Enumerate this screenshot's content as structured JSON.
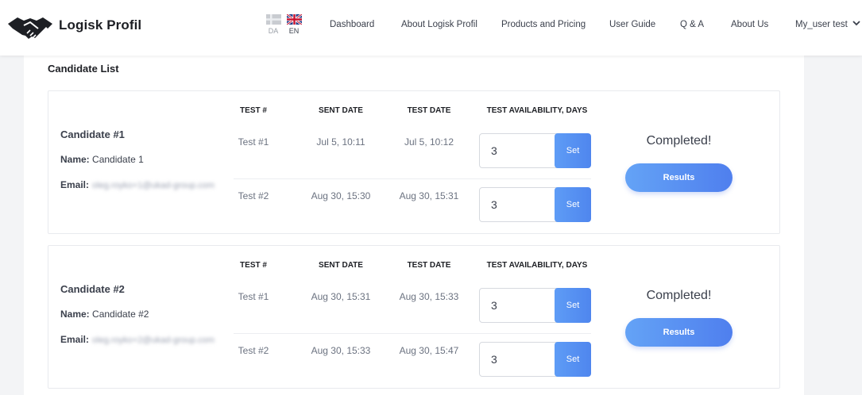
{
  "header": {
    "brand": "Logisk Profil",
    "languages": [
      {
        "code": "DA",
        "active": false
      },
      {
        "code": "EN",
        "active": true
      }
    ],
    "nav": [
      "Dashboard",
      "About Logisk Profil",
      "Products and Pricing",
      "User Guide",
      "Q & A",
      "About Us"
    ],
    "user_menu": "My_user test"
  },
  "page": {
    "title": "Candidate List"
  },
  "table_headers": {
    "test": "TEST #",
    "sent_date": "SENT DATE",
    "test_date": "TEST DATE",
    "availability": "TEST AVAILABILITY, DAYS"
  },
  "labels": {
    "name": "Name:",
    "email": "Email:",
    "set": "Set",
    "results": "Results"
  },
  "candidates": [
    {
      "title": "Candidate #1",
      "name": "Candidate 1",
      "email": "oleg.royko+1@ukad-group.com",
      "status": "Completed!",
      "tests": [
        {
          "test": "Test #1",
          "sent": "Jul 5, 10:11",
          "taken": "Jul 5, 10:12",
          "availability": "3"
        },
        {
          "test": "Test #2",
          "sent": "Aug 30, 15:30",
          "taken": "Aug 30, 15:31",
          "availability": "3"
        }
      ]
    },
    {
      "title": "Candidate #2",
      "name": "Candidate #2",
      "email": "oleg.royko+2@ukad-group.com",
      "status": "Completed!",
      "tests": [
        {
          "test": "Test #1",
          "sent": "Aug 30, 15:31",
          "taken": "Aug 30, 15:33",
          "availability": "3"
        },
        {
          "test": "Test #2",
          "sent": "Aug 30, 15:33",
          "taken": "Aug 30, 15:47",
          "availability": "3"
        }
      ]
    }
  ],
  "colors": {
    "accent": "#5490f2",
    "text": "#3a3f4b",
    "muted": "#6b7280"
  }
}
